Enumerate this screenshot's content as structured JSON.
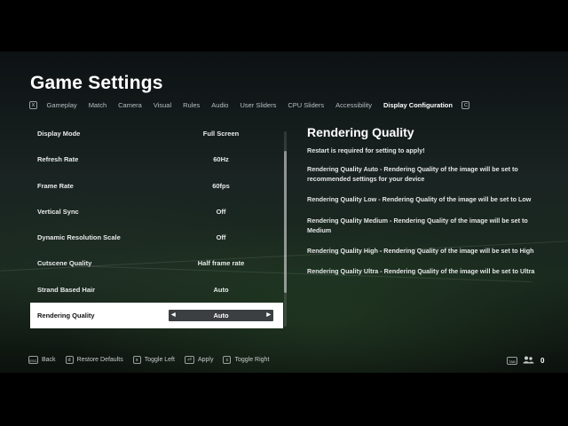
{
  "header": {
    "title": "Game Settings"
  },
  "tabs": {
    "left_key": "X",
    "right_key": "C",
    "items": [
      {
        "label": "Gameplay"
      },
      {
        "label": "Match"
      },
      {
        "label": "Camera"
      },
      {
        "label": "Visual"
      },
      {
        "label": "Rules"
      },
      {
        "label": "Audio"
      },
      {
        "label": "User Sliders"
      },
      {
        "label": "CPU Sliders"
      },
      {
        "label": "Accessibility"
      },
      {
        "label": "Display Configuration",
        "active": true
      }
    ]
  },
  "settings": [
    {
      "label": "Display Mode",
      "value": "Full Screen"
    },
    {
      "label": "Refresh Rate",
      "value": "60Hz"
    },
    {
      "label": "Frame Rate",
      "value": "60fps"
    },
    {
      "label": "Vertical Sync",
      "value": "Off"
    },
    {
      "label": "Dynamic Resolution Scale",
      "value": "Off"
    },
    {
      "label": "Cutscene Quality",
      "value": "Half frame rate"
    },
    {
      "label": "Strand Based Hair",
      "value": "Auto"
    },
    {
      "label": "Rendering Quality",
      "value": "Auto",
      "selected": true
    }
  ],
  "detail": {
    "title": "Rendering Quality",
    "paragraphs": [
      "Restart is required for setting to apply!",
      "Rendering Quality Auto - Rendering Quality of the image will be set to recommended settings for your device",
      "Rendering Quality Low - Rendering Quality of the image will be set to Low",
      "Rendering Quality Medium - Rendering Quality of the image will be set to Medium",
      "Rendering Quality High - Rendering Quality of the image will be set to High",
      "Rendering Quality Ultra - Rendering Quality of the image will be set to Ultra"
    ]
  },
  "footer": {
    "actions": [
      {
        "key": "ESC",
        "label": "Back"
      },
      {
        "key": "d",
        "label": "Restore Defaults"
      },
      {
        "key": "x",
        "label": "Toggle Left"
      },
      {
        "key": "⏎",
        "label": "Apply"
      },
      {
        "key": "c",
        "label": "Toggle Right"
      }
    ],
    "right_key": "TAB",
    "user_count": "0"
  },
  "icons": {
    "users": "users-icon",
    "arrow_left": "arrow-left-icon",
    "arrow_right": "arrow-right-icon"
  }
}
